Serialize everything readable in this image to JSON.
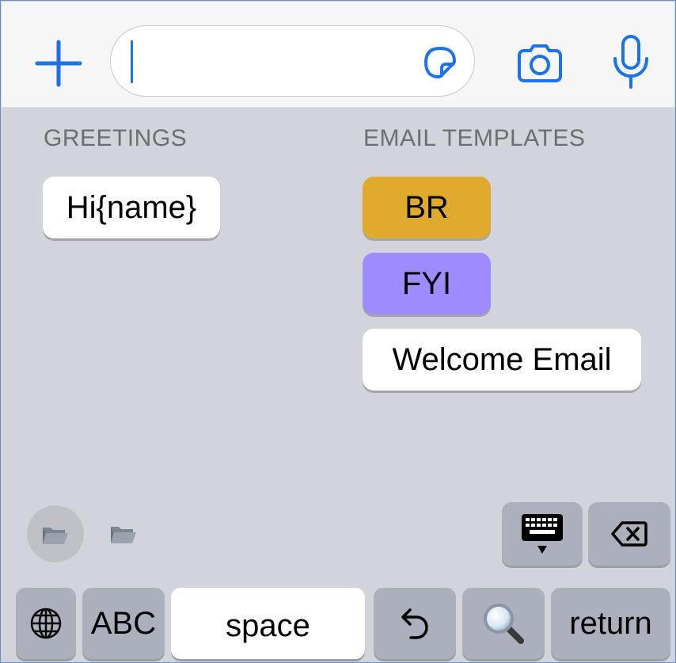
{
  "input_bar": {
    "add_icon": "plus-icon",
    "sticker_icon": "sticker-icon",
    "camera_icon": "camera-icon",
    "mic_icon": "microphone-icon",
    "accent_color": "#1a73e8",
    "message_value": ""
  },
  "greetings": {
    "title": "GREETINGS",
    "items": [
      {
        "label": "Hi{name}",
        "color": "#ffffff"
      }
    ]
  },
  "email_templates": {
    "title": "EMAIL TEMPLATES",
    "items": [
      {
        "label": "BR",
        "color": "#e0ab2d"
      },
      {
        "label": "FYI",
        "color": "#9e8bff"
      },
      {
        "label": "Welcome Email",
        "color": "#ffffff"
      }
    ]
  },
  "folders": [
    "folder-icon",
    "folder-icon"
  ],
  "keyboard": {
    "hide_keyboard_icon": "keyboard-hide-icon",
    "delete_icon": "backspace-icon",
    "globe_icon": "globe-icon",
    "abc_label": "ABC",
    "space_label": "space",
    "undo_icon": "undo-icon",
    "search_icon": "magnifier-icon",
    "return_label": "return"
  }
}
